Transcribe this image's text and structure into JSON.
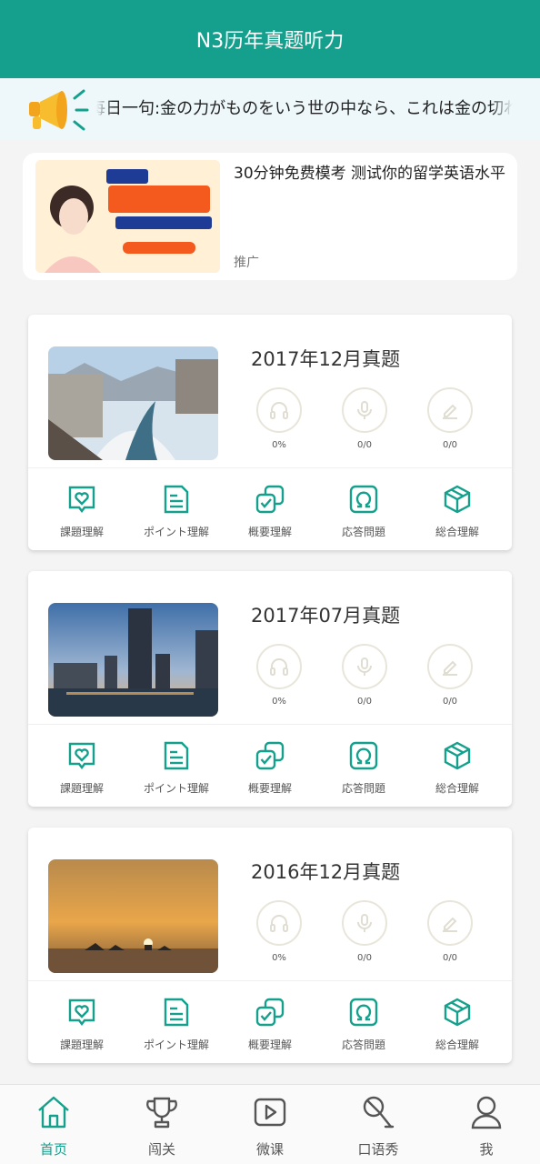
{
  "header": {
    "title": "N3历年真题听力"
  },
  "notice": {
    "text": "每日一句:金の力がものをいう世の中なら、これは金の切れ目が縁の切れ目"
  },
  "ad": {
    "title": "30分钟免费模考 测试你的留学英语水平",
    "tag": "推广"
  },
  "colors": {
    "accent": "#14a08c",
    "ring": "#e8e5da"
  },
  "cards": [
    {
      "title": "2017年12月真题",
      "photo": "snowy-river-town",
      "stats": [
        {
          "icon": "headphones-icon",
          "value": "0%"
        },
        {
          "icon": "microphone-icon",
          "value": "0/0"
        },
        {
          "icon": "pencil-icon",
          "value": "0/0"
        }
      ]
    },
    {
      "title": "2017年07月真题",
      "photo": "city-skyline-dusk",
      "stats": [
        {
          "icon": "headphones-icon",
          "value": "0%"
        },
        {
          "icon": "microphone-icon",
          "value": "0/0"
        },
        {
          "icon": "pencil-icon",
          "value": "0/0"
        }
      ]
    },
    {
      "title": "2016年12月真题",
      "photo": "sunset-over-sea",
      "stats": [
        {
          "icon": "headphones-icon",
          "value": "0%"
        },
        {
          "icon": "microphone-icon",
          "value": "0/0"
        },
        {
          "icon": "pencil-icon",
          "value": "0/0"
        }
      ]
    }
  ],
  "categories": [
    {
      "label": "課題理解",
      "icon": "heart-bubble-icon"
    },
    {
      "label": "ポイント理解",
      "icon": "document-icon"
    },
    {
      "label": "概要理解",
      "icon": "stacked-check-icon"
    },
    {
      "label": "応答問題",
      "icon": "omega-icon"
    },
    {
      "label": "総合理解",
      "icon": "cube-icon"
    }
  ],
  "tabbar": [
    {
      "label": "首页",
      "icon": "home-icon",
      "active": true
    },
    {
      "label": "闯关",
      "icon": "trophy-icon",
      "active": false
    },
    {
      "label": "微课",
      "icon": "video-play-icon",
      "active": false
    },
    {
      "label": "口语秀",
      "icon": "microphone-icon",
      "active": false
    },
    {
      "label": "我",
      "icon": "user-icon",
      "active": false
    }
  ]
}
